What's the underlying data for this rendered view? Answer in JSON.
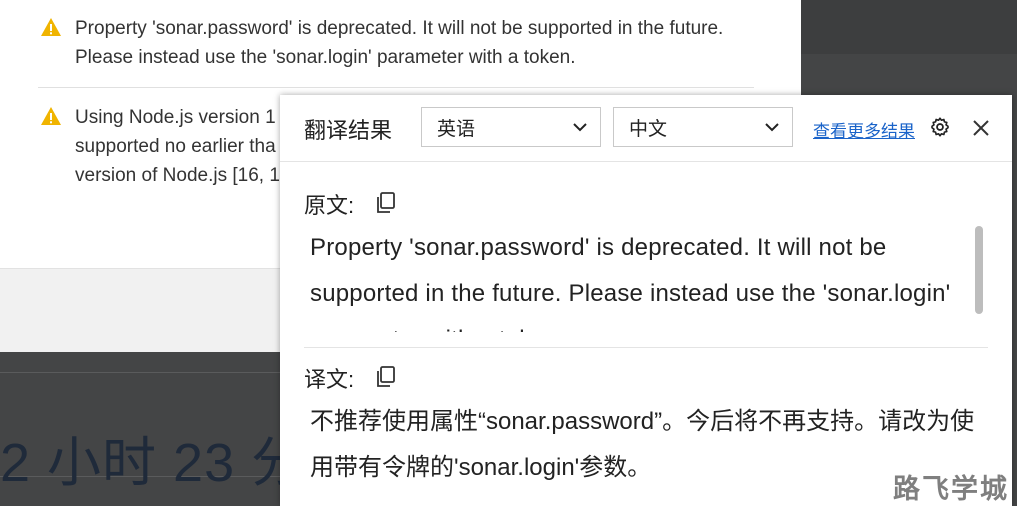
{
  "background": {
    "warnings": [
      {
        "text_line1": "Property 'sonar.password' is deprecated. It will not be supported in the future.",
        "text_line2": "Please instead use the 'sonar.login' parameter with a token."
      },
      {
        "text_line1": "Using Node.js version 1",
        "text_line2": "supported no earlier tha",
        "text_line3": "version of Node.js [16, 1"
      }
    ],
    "elapsed_text": "2 小时 23 分"
  },
  "popup": {
    "title": "翻译结果",
    "source_language": "英语",
    "target_language": "中文",
    "more_results_link": "查看更多结果",
    "original_label": "原文:",
    "original_text": "Property 'sonar.password' is deprecated. It will not be supported in the future. Please instead use the 'sonar.login' parameter with a token.",
    "translation_label": "译文:",
    "translation_text": "不推荐使用属性“sonar.password”。今后将不再支持。请改为使用带有令牌的'sonar.login'参数。"
  },
  "watermark": "路飞学城",
  "colors": {
    "warning": "#f0b400",
    "link": "#1a63c9",
    "overlay": "#444546"
  }
}
